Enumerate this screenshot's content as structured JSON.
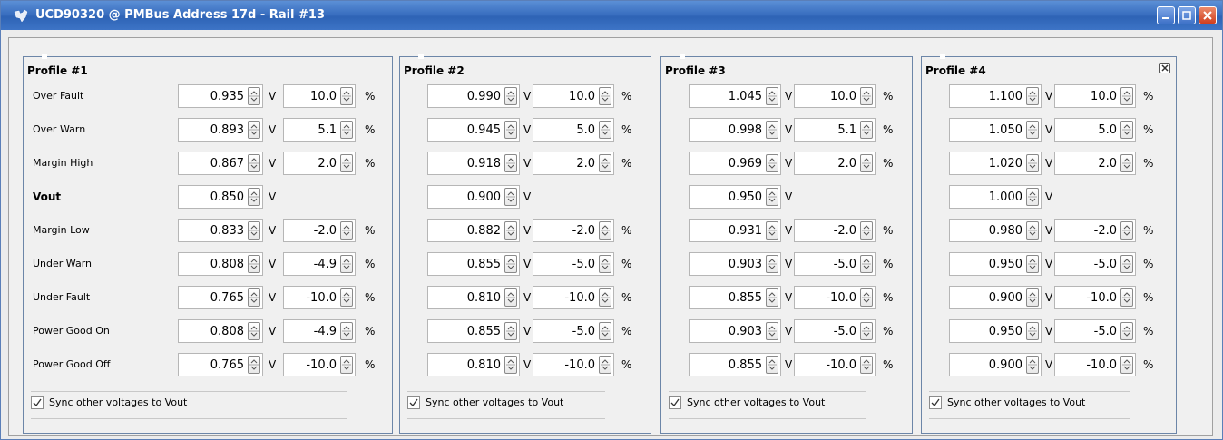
{
  "window": {
    "title": "UCD90320 @ PMBus Address 17d - Rail #13"
  },
  "sync_label": "Sync other voltages to Vout",
  "volt_unit": "V",
  "pct_unit": "%",
  "rows": [
    "Over Fault",
    "Over Warn",
    "Margin High",
    "Vout",
    "Margin Low",
    "Under Warn",
    "Under Fault",
    "Power Good On",
    "Power Good Off"
  ],
  "profiles": [
    {
      "title": "Profile #1",
      "values": [
        {
          "v": "0.935",
          "p": "10.0"
        },
        {
          "v": "0.893",
          "p": "5.1"
        },
        {
          "v": "0.867",
          "p": "2.0"
        },
        {
          "v": "0.850",
          "p": ""
        },
        {
          "v": "0.833",
          "p": "-2.0"
        },
        {
          "v": "0.808",
          "p": "-4.9"
        },
        {
          "v": "0.765",
          "p": "-10.0"
        },
        {
          "v": "0.808",
          "p": "-4.9"
        },
        {
          "v": "0.765",
          "p": "-10.0"
        }
      ]
    },
    {
      "title": "Profile #2",
      "values": [
        {
          "v": "0.990",
          "p": "10.0"
        },
        {
          "v": "0.945",
          "p": "5.0"
        },
        {
          "v": "0.918",
          "p": "2.0"
        },
        {
          "v": "0.900",
          "p": ""
        },
        {
          "v": "0.882",
          "p": "-2.0"
        },
        {
          "v": "0.855",
          "p": "-5.0"
        },
        {
          "v": "0.810",
          "p": "-10.0"
        },
        {
          "v": "0.855",
          "p": "-5.0"
        },
        {
          "v": "0.810",
          "p": "-10.0"
        }
      ]
    },
    {
      "title": "Profile #3",
      "values": [
        {
          "v": "1.045",
          "p": "10.0"
        },
        {
          "v": "0.998",
          "p": "5.1"
        },
        {
          "v": "0.969",
          "p": "2.0"
        },
        {
          "v": "0.950",
          "p": ""
        },
        {
          "v": "0.931",
          "p": "-2.0"
        },
        {
          "v": "0.903",
          "p": "-5.0"
        },
        {
          "v": "0.855",
          "p": "-10.0"
        },
        {
          "v": "0.903",
          "p": "-5.0"
        },
        {
          "v": "0.855",
          "p": "-10.0"
        }
      ]
    },
    {
      "title": "Profile #4",
      "values": [
        {
          "v": "1.100",
          "p": "10.0"
        },
        {
          "v": "1.050",
          "p": "5.0"
        },
        {
          "v": "1.020",
          "p": "2.0"
        },
        {
          "v": "1.000",
          "p": ""
        },
        {
          "v": "0.980",
          "p": "-2.0"
        },
        {
          "v": "0.950",
          "p": "-5.0"
        },
        {
          "v": "0.900",
          "p": "-10.0"
        },
        {
          "v": "0.950",
          "p": "-5.0"
        },
        {
          "v": "0.900",
          "p": "-10.0"
        }
      ]
    }
  ]
}
